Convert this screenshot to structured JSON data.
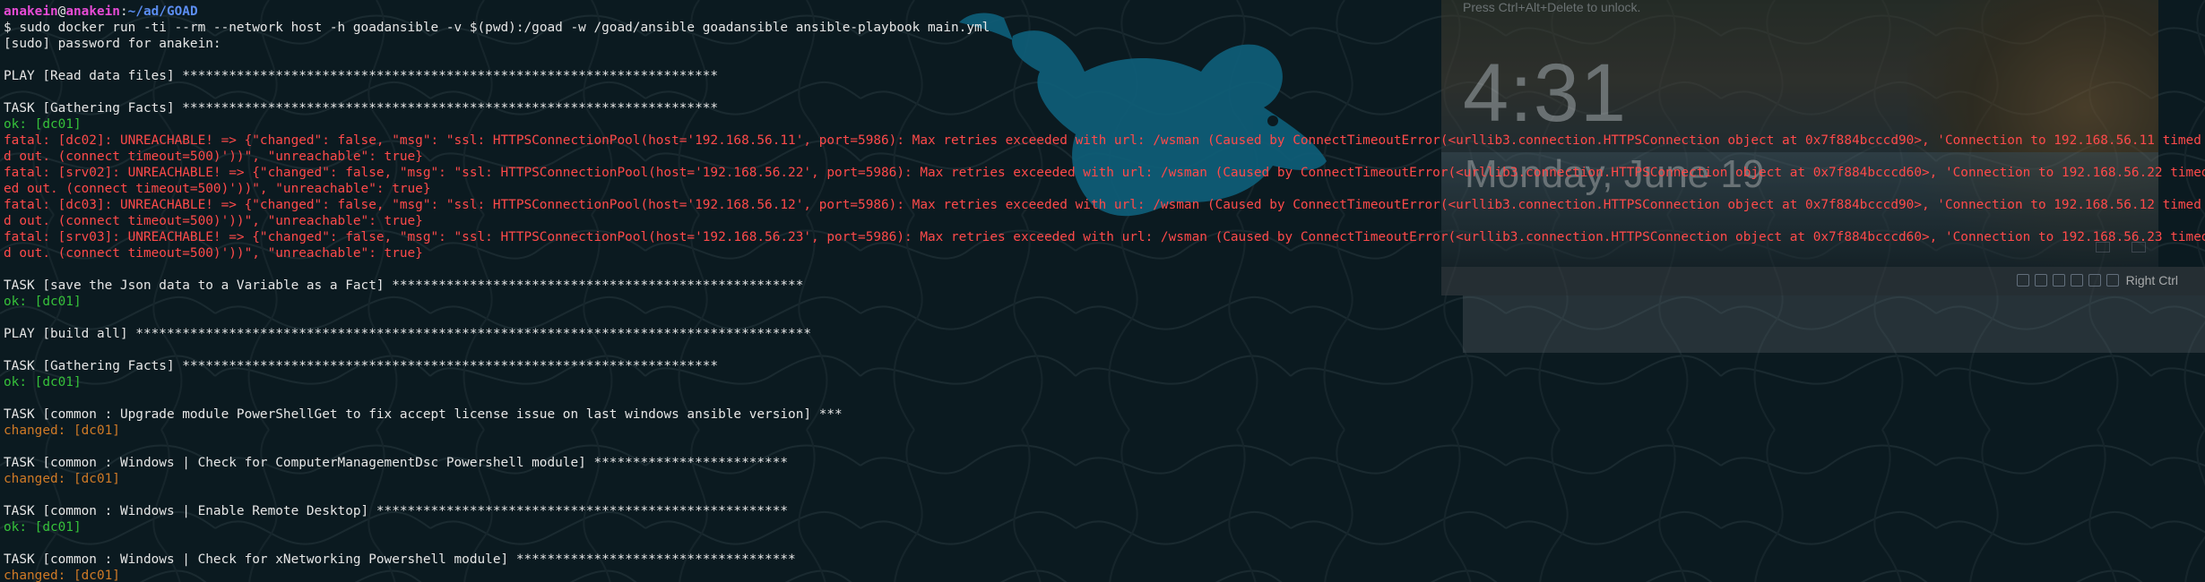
{
  "terminal": {
    "prompt": {
      "user": "anakein",
      "at": "@",
      "host": "anakein",
      "sep": ":",
      "path": "~/ad/GOAD",
      "symbol": "$",
      "command": " sudo docker run -ti --rm --network host -h goadansible -v $(pwd):/goad -w /goad/ansible goadansible ansible-playbook main.yml"
    },
    "lines": [
      {
        "text": "[sudo] password for anakein:",
        "type": "plain"
      },
      {
        "text": "",
        "type": "plain"
      },
      {
        "text": "PLAY [Read data files] *********************************************************************",
        "type": "plain"
      },
      {
        "text": "",
        "type": "plain"
      },
      {
        "text": "TASK [Gathering Facts] *********************************************************************",
        "type": "plain"
      },
      {
        "text": "ok: [dc01]",
        "type": "ok"
      },
      {
        "text": "fatal: [dc02]: UNREACHABLE! => {\"changed\": false, \"msg\": \"ssl: HTTPSConnectionPool(host='192.168.56.11', port=5986): Max retries exceeded with url: /wsman (Caused by ConnectTimeoutError(<urllib3.connection.HTTPSConnection object at 0x7f884bcccd90>, 'Connection to 192.168.56.11 timed out. (connect timeout=500)'))\", \"unreachable\": true}",
        "type": "fatal"
      },
      {
        "text": "d out. (connect timeout=500)'))\", \"unreachable\": true}",
        "type": "fatal"
      },
      {
        "text": "fatal: [srv02]: UNREACHABLE! => {\"changed\": false, \"msg\": \"ssl: HTTPSConnectionPool(host='192.168.56.22', port=5986): Max retries exceeded with url: /wsman (Caused by ConnectTimeoutError(<urllib3.connection.HTTPSConnection object at 0x7f884bcccd60>, 'Connection to 192.168.56.22 timed out. (connect timeout=500)'))\", \"unreachable\": true}",
        "type": "fatal"
      },
      {
        "text": "ed out. (connect timeout=500)'))\", \"unreachable\": true}",
        "type": "fatal"
      },
      {
        "text": "fatal: [dc03]: UNREACHABLE! => {\"changed\": false, \"msg\": \"ssl: HTTPSConnectionPool(host='192.168.56.12', port=5986): Max retries exceeded with url: /wsman (Caused by ConnectTimeoutError(<urllib3.connection.HTTPSConnection object at 0x7f884bcccd90>, 'Connection to 192.168.56.12 timed out. (connect timeout=500)'))\", \"unreachable\": true}",
        "type": "fatal"
      },
      {
        "text": "d out. (connect timeout=500)'))\", \"unreachable\": true}",
        "type": "fatal"
      },
      {
        "text": "fatal: [srv03]: UNREACHABLE! => {\"changed\": false, \"msg\": \"ssl: HTTPSConnectionPool(host='192.168.56.23', port=5986): Max retries exceeded with url: /wsman (Caused by ConnectTimeoutError(<urllib3.connection.HTTPSConnection object at 0x7f884bcccd60>, 'Connection to 192.168.56.23 timed out. (connect timeout=500)'))\", \"unreachable\": true}",
        "type": "fatal"
      },
      {
        "text": "d out. (connect timeout=500)'))\", \"unreachable\": true}",
        "type": "fatal"
      },
      {
        "text": "",
        "type": "plain"
      },
      {
        "text": "TASK [save the Json data to a Variable as a Fact] *****************************************************",
        "type": "plain"
      },
      {
        "text": "ok: [dc01]",
        "type": "ok"
      },
      {
        "text": "",
        "type": "plain"
      },
      {
        "text": "PLAY [build all] ***************************************************************************************",
        "type": "plain"
      },
      {
        "text": "",
        "type": "plain"
      },
      {
        "text": "TASK [Gathering Facts] *********************************************************************",
        "type": "plain"
      },
      {
        "text": "ok: [dc01]",
        "type": "ok"
      },
      {
        "text": "",
        "type": "plain"
      },
      {
        "text": "TASK [common : Upgrade module PowerShellGet to fix accept license issue on last windows ansible version] ***",
        "type": "plain"
      },
      {
        "text": "changed: [dc01]",
        "type": "changed"
      },
      {
        "text": "",
        "type": "plain"
      },
      {
        "text": "TASK [common : Windows | Check for ComputerManagementDsc Powershell module] *************************",
        "type": "plain"
      },
      {
        "text": "changed: [dc01]",
        "type": "changed"
      },
      {
        "text": "",
        "type": "plain"
      },
      {
        "text": "TASK [common : Windows | Enable Remote Desktop] *****************************************************",
        "type": "plain"
      },
      {
        "text": "ok: [dc01]",
        "type": "ok"
      },
      {
        "text": "",
        "type": "plain"
      },
      {
        "text": "TASK [common : Windows | Check for xNetworking Powershell module] ************************************",
        "type": "plain"
      },
      {
        "text": "changed: [dc01]",
        "type": "changed"
      }
    ]
  },
  "vm_window": {
    "hint": "Press Ctrl+Alt+Delete to unlock.",
    "time": "4:31",
    "date": "Monday, June 19",
    "host_key": "Right Ctrl"
  },
  "colors": {
    "background": "#0b1a20",
    "user": "#e64bd5",
    "path": "#5b8df0",
    "ok": "#36c13a",
    "fatal": "#ff4a4a",
    "changed": "#d07a26",
    "wallpaper_mouse": "#0e5f7a"
  },
  "icons": {
    "wallpaper": "mouse-mascot-icon",
    "vm_status": [
      "usb-icon",
      "network-icon",
      "shared-folder-icon",
      "display-icon",
      "record-icon",
      "cpu-icon"
    ]
  }
}
